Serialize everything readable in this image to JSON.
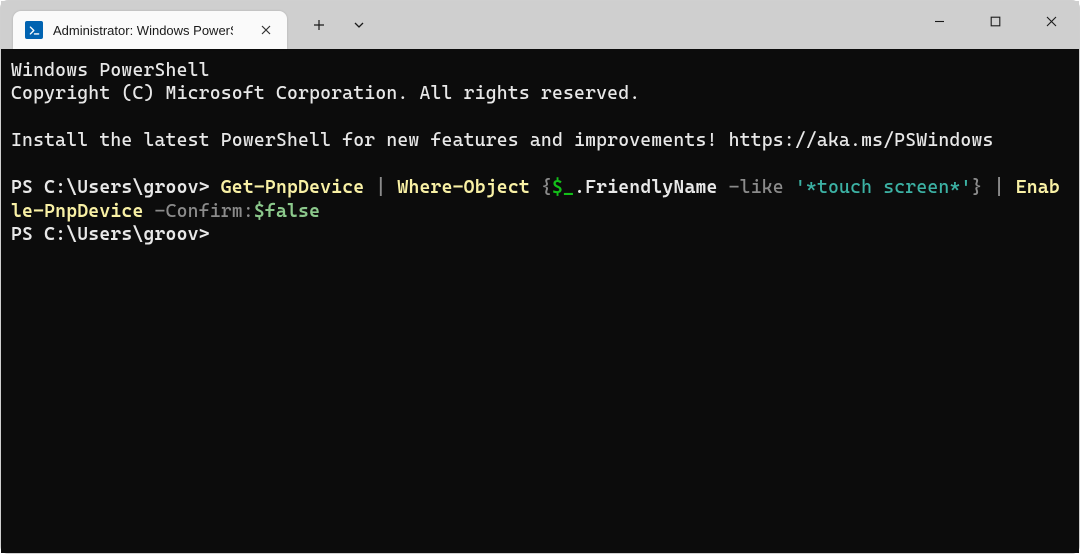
{
  "tab": {
    "title": "Administrator: Windows PowerS"
  },
  "terminal": {
    "banner_line1": "Windows PowerShell",
    "banner_line2": "Copyright (C) Microsoft Corporation. All rights reserved.",
    "banner_line3": "Install the latest PowerShell for new features and improvements! https://aka.ms/PSWindows",
    "prompt": "PS C:\\Users\\groov> ",
    "cmd": {
      "p1": "Get-PnpDevice ",
      "pipe1": "|",
      "p2": " Where-Object ",
      "brace_open": "{",
      "dollar_underscore": "$_",
      "friendly": ".FriendlyName ",
      "like": "-like",
      "str": " '*touch screen*'",
      "brace_close": "}",
      "wrap_pipe": " | ",
      "p3": "Enable-PnpDevice ",
      "confirm": "-Confirm:",
      "false": "$false"
    }
  }
}
